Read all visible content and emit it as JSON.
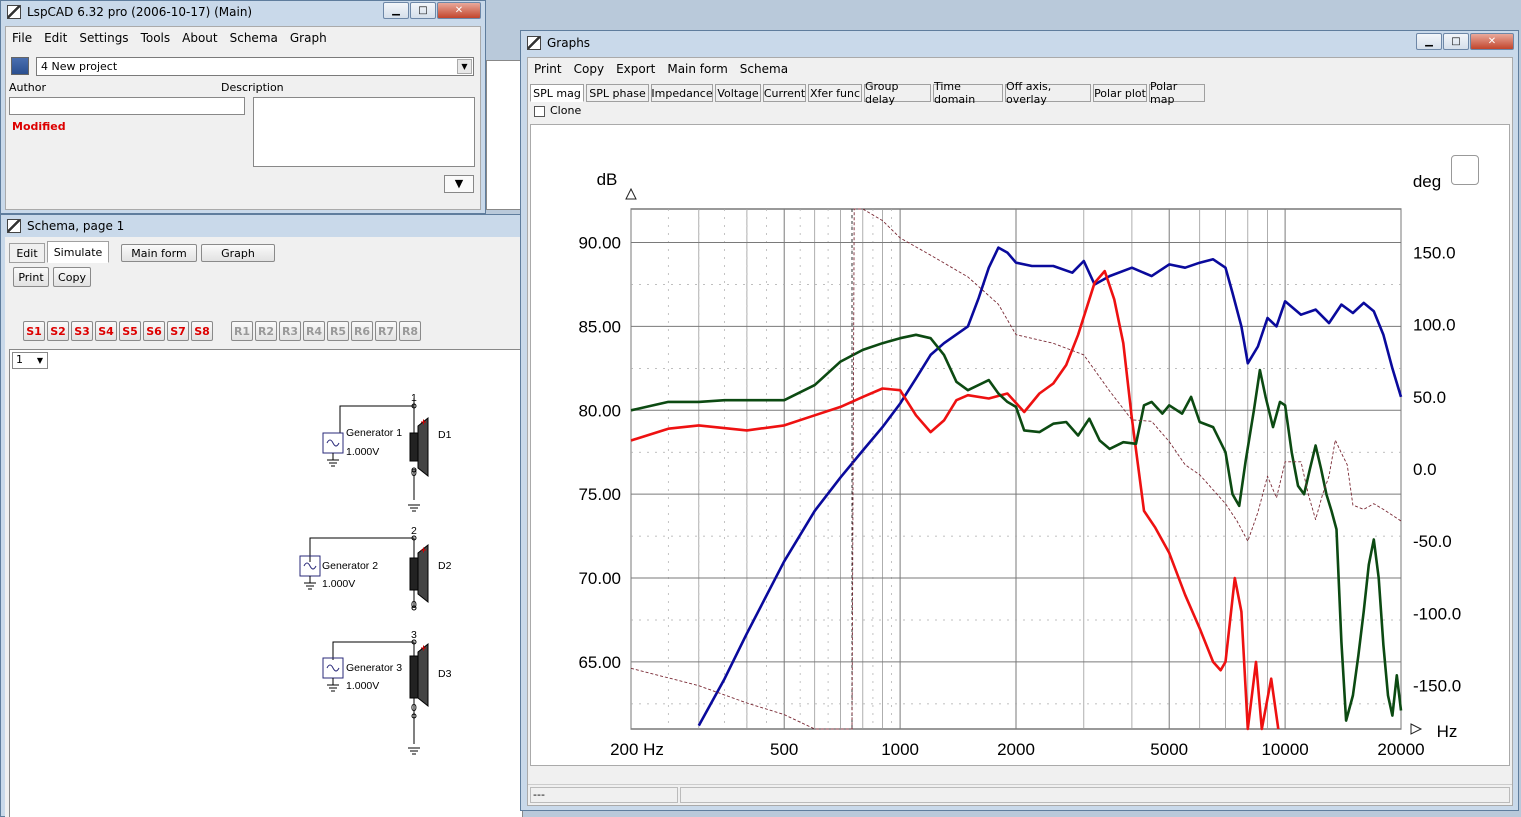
{
  "main_window": {
    "title": "LspCAD 6.32 pro (2006-10-17) (Main)",
    "menu": [
      "File",
      "Edit",
      "Settings",
      "Tools",
      "About",
      "Schema",
      "Graph"
    ],
    "project": "4 New project",
    "author_label": "Author",
    "description_label": "Description",
    "status": "Modified"
  },
  "schema_window": {
    "title": "Schema, page 1",
    "tabs": [
      "Edit",
      "Simulate",
      "Main form",
      "Graph"
    ],
    "print_label": "Print",
    "copy_label": "Copy",
    "s_buttons": [
      "S1",
      "S2",
      "S3",
      "S4",
      "S5",
      "S6",
      "S7",
      "S8"
    ],
    "r_buttons": [
      "R1",
      "R2",
      "R3",
      "R4",
      "R5",
      "R6",
      "R7",
      "R8"
    ],
    "page_select": "1",
    "generators": [
      {
        "name": "Generator 1",
        "voltage": "1.000V",
        "node": "1",
        "driver": "D1"
      },
      {
        "name": "Generator 2",
        "voltage": "1.000V",
        "node": "2",
        "driver": "D2"
      },
      {
        "name": "Generator 3",
        "voltage": "1.000V",
        "node": "3",
        "driver": "D3"
      }
    ],
    "ground_node": "0"
  },
  "graphs_window": {
    "title": "Graphs",
    "menu": [
      "Print",
      "Copy",
      "Export",
      "Main form",
      "Schema"
    ],
    "tabs": [
      "SPL mag",
      "SPL phase",
      "Impedance",
      "Voltage",
      "Current",
      "Xfer func",
      "Group delay",
      "Time domain",
      "Off axis, overlay",
      "Polar plot",
      "Polar map"
    ],
    "clone_label": "Clone",
    "status": "---"
  },
  "colors": {
    "blue": "#0a0a9c",
    "red": "#ee1111",
    "green": "#0c4a12",
    "phase": "#7a2a35"
  },
  "chart_data": {
    "type": "line",
    "xscale": "log",
    "xlim": [
      200,
      20000
    ],
    "ylim": [
      61,
      92
    ],
    "ylim_right": [
      -180,
      180
    ],
    "ylabel": "dB",
    "ylabel_right": "deg",
    "xunit": "Hz",
    "x_ticks": [
      "200 Hz",
      "500",
      "1000",
      "2000",
      "5000",
      "10000",
      "20000"
    ],
    "x_tick_values": [
      200,
      500,
      1000,
      2000,
      5000,
      10000,
      20000
    ],
    "y_ticks": [
      "90.00",
      "85.00",
      "80.00",
      "75.00",
      "70.00",
      "65.00"
    ],
    "y_tick_values": [
      90,
      85,
      80,
      75,
      70,
      65
    ],
    "y_right_ticks": [
      "150.0",
      "100.0",
      "50.0",
      "0.0",
      "-50.0",
      "-100.0",
      "-150.0"
    ],
    "y_right_tick_values": [
      150,
      100,
      50,
      0,
      -50,
      -100,
      -150
    ],
    "marker_x": 750,
    "grid": true,
    "series": [
      {
        "color": "blue",
        "points": [
          [
            300,
            61.2
          ],
          [
            350,
            64
          ],
          [
            400,
            66.7
          ],
          [
            500,
            71
          ],
          [
            600,
            74
          ],
          [
            700,
            76
          ],
          [
            800,
            77.6
          ],
          [
            900,
            79
          ],
          [
            1000,
            80.4
          ],
          [
            1100,
            81.9
          ],
          [
            1200,
            83.3
          ],
          [
            1300,
            84
          ],
          [
            1500,
            85
          ],
          [
            1600,
            86.7
          ],
          [
            1700,
            88.5
          ],
          [
            1800,
            89.7
          ],
          [
            1900,
            89.4
          ],
          [
            2000,
            88.8
          ],
          [
            2200,
            88.6
          ],
          [
            2500,
            88.6
          ],
          [
            2800,
            88.2
          ],
          [
            3000,
            88.9
          ],
          [
            3200,
            87.5
          ],
          [
            3500,
            88
          ],
          [
            4000,
            88.5
          ],
          [
            4500,
            88
          ],
          [
            5000,
            88.7
          ],
          [
            5500,
            88.5
          ],
          [
            6000,
            88.8
          ],
          [
            6500,
            89
          ],
          [
            7000,
            88.5
          ],
          [
            7300,
            87
          ],
          [
            7700,
            85
          ],
          [
            8000,
            82.8
          ],
          [
            8500,
            83.8
          ],
          [
            9000,
            85.5
          ],
          [
            9500,
            85
          ],
          [
            10000,
            86.5
          ],
          [
            11000,
            85.7
          ],
          [
            12000,
            86
          ],
          [
            13000,
            85.2
          ],
          [
            14000,
            86.3
          ],
          [
            15000,
            85.8
          ],
          [
            16000,
            86.4
          ],
          [
            17000,
            85.9
          ],
          [
            18000,
            84.5
          ],
          [
            19000,
            82.5
          ],
          [
            20000,
            80.8
          ]
        ]
      },
      {
        "color": "red",
        "points": [
          [
            200,
            78.2
          ],
          [
            250,
            78.9
          ],
          [
            300,
            79.1
          ],
          [
            400,
            78.8
          ],
          [
            500,
            79.1
          ],
          [
            600,
            79.7
          ],
          [
            700,
            80.2
          ],
          [
            800,
            80.8
          ],
          [
            900,
            81.3
          ],
          [
            1000,
            81.2
          ],
          [
            1100,
            79.7
          ],
          [
            1200,
            78.7
          ],
          [
            1300,
            79.4
          ],
          [
            1400,
            80.6
          ],
          [
            1500,
            80.9
          ],
          [
            1700,
            80.7
          ],
          [
            1900,
            81
          ],
          [
            2100,
            79.9
          ],
          [
            2300,
            81
          ],
          [
            2500,
            81.6
          ],
          [
            2700,
            82.7
          ],
          [
            2900,
            84.5
          ],
          [
            3200,
            87.6
          ],
          [
            3400,
            88.3
          ],
          [
            3600,
            86.6
          ],
          [
            3800,
            84
          ],
          [
            4000,
            79.5
          ],
          [
            4300,
            74
          ],
          [
            4600,
            73
          ],
          [
            5000,
            71.5
          ],
          [
            5500,
            69
          ],
          [
            6000,
            67
          ],
          [
            6500,
            65
          ],
          [
            6800,
            64.5
          ],
          [
            7000,
            65
          ],
          [
            7400,
            70
          ],
          [
            7700,
            68
          ],
          [
            8000,
            61
          ],
          [
            8400,
            65
          ],
          [
            8700,
            61
          ],
          [
            9200,
            64
          ],
          [
            9600,
            61
          ]
        ]
      },
      {
        "color": "green",
        "points": [
          [
            200,
            80
          ],
          [
            250,
            80.5
          ],
          [
            300,
            80.5
          ],
          [
            350,
            80.6
          ],
          [
            400,
            80.6
          ],
          [
            450,
            80.6
          ],
          [
            500,
            80.6
          ],
          [
            600,
            81.5
          ],
          [
            700,
            82.9
          ],
          [
            800,
            83.6
          ],
          [
            900,
            84
          ],
          [
            1000,
            84.3
          ],
          [
            1100,
            84.5
          ],
          [
            1200,
            84.3
          ],
          [
            1300,
            83.3
          ],
          [
            1400,
            81.7
          ],
          [
            1500,
            81.2
          ],
          [
            1700,
            81.8
          ],
          [
            1800,
            81
          ],
          [
            1900,
            80.5
          ],
          [
            2000,
            80.2
          ],
          [
            2100,
            78.8
          ],
          [
            2300,
            78.7
          ],
          [
            2500,
            79.2
          ],
          [
            2700,
            79.3
          ],
          [
            2900,
            78.5
          ],
          [
            3100,
            79.5
          ],
          [
            3300,
            78.2
          ],
          [
            3500,
            77.7
          ],
          [
            3800,
            78.1
          ],
          [
            4100,
            78
          ],
          [
            4300,
            80.3
          ],
          [
            4500,
            80.5
          ],
          [
            4800,
            79.8
          ],
          [
            5000,
            80.3
          ],
          [
            5400,
            79.8
          ],
          [
            5700,
            80.8
          ],
          [
            6000,
            79.3
          ],
          [
            6500,
            79
          ],
          [
            7000,
            77.5
          ],
          [
            7300,
            75
          ],
          [
            7600,
            74.3
          ],
          [
            7900,
            77
          ],
          [
            8300,
            80
          ],
          [
            8600,
            82.4
          ],
          [
            8900,
            80.8
          ],
          [
            9300,
            79
          ],
          [
            9700,
            80.5
          ],
          [
            10000,
            80.3
          ],
          [
            10400,
            77.5
          ],
          [
            10800,
            75.5
          ],
          [
            11200,
            75
          ],
          [
            11600,
            76.5
          ],
          [
            12000,
            77.9
          ],
          [
            12400,
            76.5
          ],
          [
            12800,
            75
          ],
          [
            13200,
            74
          ],
          [
            13600,
            72.9
          ],
          [
            14000,
            66.2
          ],
          [
            14400,
            61.5
          ],
          [
            15000,
            63
          ],
          [
            15500,
            65.4
          ],
          [
            16000,
            68
          ],
          [
            16500,
            70.8
          ],
          [
            17000,
            72.3
          ],
          [
            17500,
            70
          ],
          [
            18000,
            66
          ],
          [
            18500,
            63
          ],
          [
            19000,
            61.8
          ],
          [
            19500,
            64.2
          ],
          [
            20000,
            62.1
          ]
        ]
      },
      {
        "color": "phase",
        "dashed": true,
        "axis": "right",
        "points": [
          [
            200,
            -138
          ],
          [
            300,
            -150
          ],
          [
            400,
            -162
          ],
          [
            500,
            -170
          ],
          [
            600,
            -180
          ],
          [
            700,
            -186
          ],
          [
            750,
            -186
          ],
          [
            760,
            185
          ],
          [
            800,
            180
          ],
          [
            900,
            172
          ],
          [
            1000,
            160
          ],
          [
            1200,
            148
          ],
          [
            1500,
            133
          ],
          [
            1800,
            114
          ],
          [
            2000,
            93
          ],
          [
            2500,
            87
          ],
          [
            3000,
            79
          ],
          [
            3500,
            54
          ],
          [
            4000,
            34
          ],
          [
            4500,
            33
          ],
          [
            5000,
            19
          ],
          [
            5500,
            3
          ],
          [
            6000,
            -4
          ],
          [
            7000,
            -24
          ],
          [
            7500,
            -36
          ],
          [
            8000,
            -50
          ],
          [
            8500,
            -30
          ],
          [
            9000,
            -5
          ],
          [
            9500,
            -20
          ],
          [
            10000,
            5
          ],
          [
            11000,
            5
          ],
          [
            11500,
            -18
          ],
          [
            12000,
            -35
          ],
          [
            12500,
            -18
          ],
          [
            13000,
            -5
          ],
          [
            13500,
            20
          ],
          [
            14000,
            11
          ],
          [
            14500,
            3
          ],
          [
            15000,
            -25
          ],
          [
            16000,
            -28
          ],
          [
            17000,
            -24
          ],
          [
            18000,
            -28
          ],
          [
            20000,
            -36
          ]
        ]
      }
    ]
  }
}
